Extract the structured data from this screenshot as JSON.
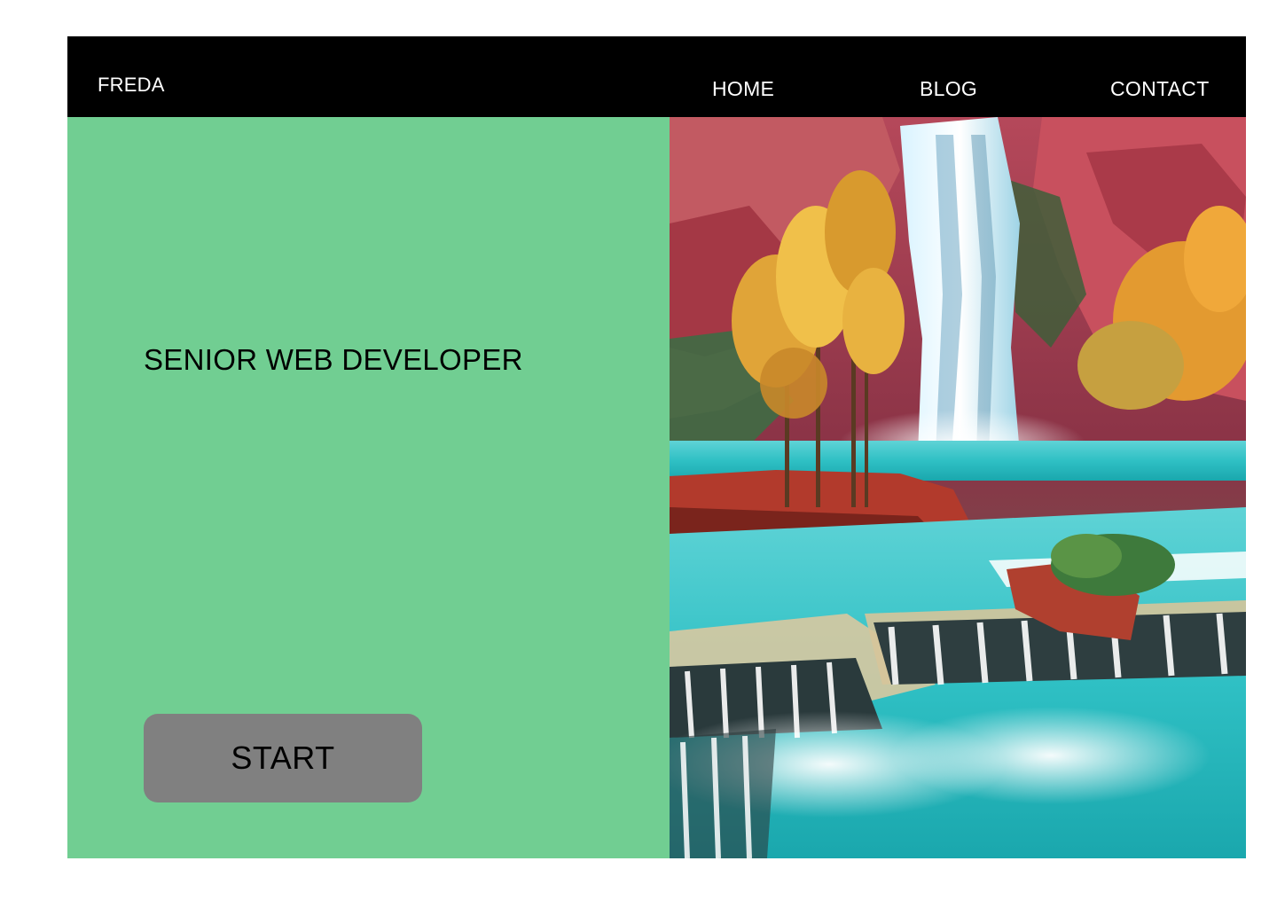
{
  "nav": {
    "brand": "FREDA",
    "links": [
      {
        "label": "HOME"
      },
      {
        "label": "BLOG"
      },
      {
        "label": "CONTACT"
      }
    ]
  },
  "hero": {
    "headline": "SENIOR WEB DEVELOPER",
    "button_label": "START",
    "image_icon": "waterfall-landscape-photo"
  },
  "colors": {
    "navbar": "#000000",
    "hero_left_bg": "#71ce92",
    "button_bg": "#808080",
    "nav_text": "#ffffff"
  }
}
